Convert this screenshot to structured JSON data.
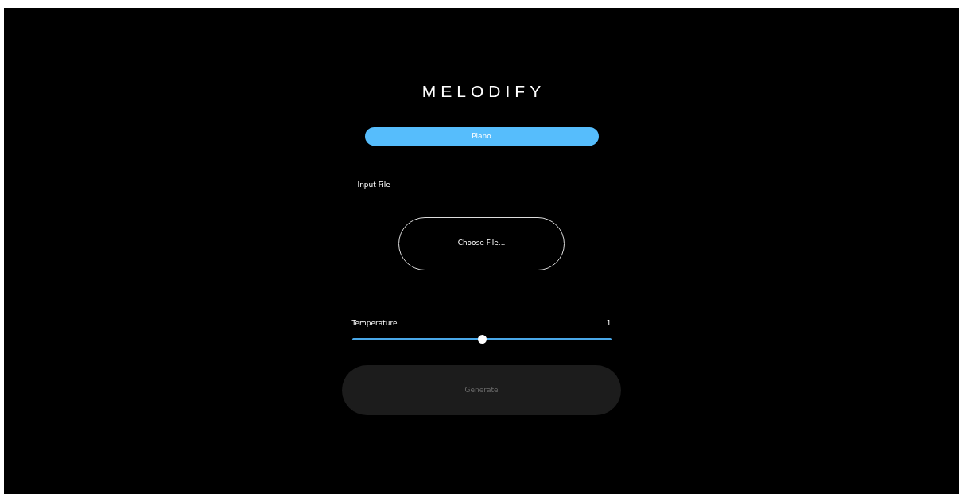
{
  "title": "MELODIFY",
  "instrument_button": {
    "label": "Piano",
    "selected": true
  },
  "input_file": {
    "label": "Input File",
    "button": "Choose File..."
  },
  "temperature": {
    "label": "Temperature",
    "reading": "1",
    "level": 0.5
  },
  "generate_button": {
    "label": "Generate",
    "disabled": true
  }
}
